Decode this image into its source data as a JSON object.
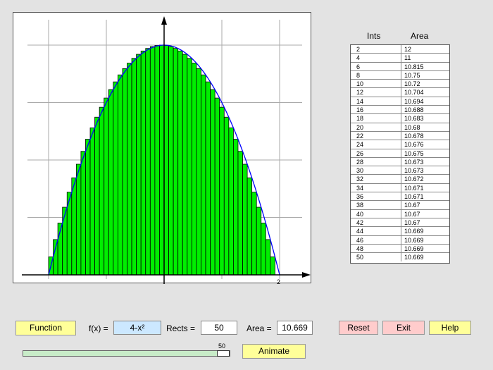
{
  "plot": {
    "function_label": "4-x²",
    "rect_count": 50,
    "x_range": [
      -2,
      2
    ],
    "x_tick_label": "2",
    "curve_color": "#0000ff",
    "rect_fill": "#00ee00",
    "grid_on": true
  },
  "table": {
    "header_ints": "Ints",
    "header_area": "Area",
    "rows": [
      {
        "ints": "2",
        "area": "12"
      },
      {
        "ints": "4",
        "area": "11"
      },
      {
        "ints": "6",
        "area": "10.815"
      },
      {
        "ints": "8",
        "area": "10.75"
      },
      {
        "ints": "10",
        "area": "10.72"
      },
      {
        "ints": "12",
        "area": "10.704"
      },
      {
        "ints": "14",
        "area": "10.694"
      },
      {
        "ints": "16",
        "area": "10.688"
      },
      {
        "ints": "18",
        "area": "10.683"
      },
      {
        "ints": "20",
        "area": "10.68"
      },
      {
        "ints": "22",
        "area": "10.678"
      },
      {
        "ints": "24",
        "area": "10.676"
      },
      {
        "ints": "26",
        "area": "10.675"
      },
      {
        "ints": "28",
        "area": "10.673"
      },
      {
        "ints": "30",
        "area": "10.673"
      },
      {
        "ints": "32",
        "area": "10.672"
      },
      {
        "ints": "34",
        "area": "10.671"
      },
      {
        "ints": "36",
        "area": "10.671"
      },
      {
        "ints": "38",
        "area": "10.67"
      },
      {
        "ints": "40",
        "area": "10.67"
      },
      {
        "ints": "42",
        "area": "10.67"
      },
      {
        "ints": "44",
        "area": "10.669"
      },
      {
        "ints": "46",
        "area": "10.669"
      },
      {
        "ints": "48",
        "area": "10.669"
      },
      {
        "ints": "50",
        "area": "10.669"
      }
    ]
  },
  "controls": {
    "function_button": "Function",
    "fx_label": "f(x) =",
    "fx_value": "4-x²",
    "rects_label": "Rects =",
    "rects_value": "50",
    "area_label": "Area =",
    "area_value": "10.669",
    "reset_button": "Reset",
    "exit_button": "Exit",
    "help_button": "Help",
    "animate_button": "Animate",
    "slider_value_label": "50",
    "slider_fraction": 1.0
  }
}
